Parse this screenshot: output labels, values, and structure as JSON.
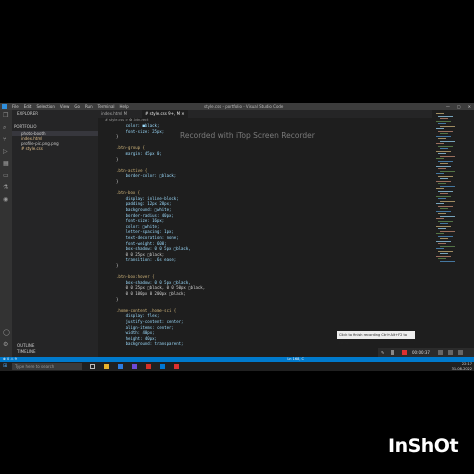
{
  "window": {
    "title": "style.css - portfolio - Visual Studio Code",
    "menu": [
      "File",
      "Edit",
      "Selection",
      "View",
      "Go",
      "Run",
      "Terminal",
      "Help"
    ],
    "controls": [
      "—",
      "▢",
      "✕"
    ]
  },
  "activity_icons": [
    "files-icon",
    "search-icon",
    "source-control-icon",
    "run-debug-icon",
    "extensions-icon",
    "remote-icon",
    "testing-icon",
    "docker-icon",
    "account-icon",
    "settings-icon"
  ],
  "sidebar": {
    "header": "EXPLORER",
    "section": "PORTFOLIO",
    "items": [
      {
        "label": "photo-booth"
      },
      {
        "label": "index.html"
      },
      {
        "label": "profile-pic.png.png"
      },
      {
        "label": "# style.css"
      }
    ],
    "outline": "OUTLINE",
    "timeline": "TIMELINE"
  },
  "tabs": [
    {
      "label": "index.html M"
    },
    {
      "label": "# style.css 9+, M ✕"
    }
  ],
  "breadcrumb": "# style.css > ✿ .btn-rect",
  "code": [
    {
      "n": "",
      "t": "    color: ■black;"
    },
    {
      "n": "",
      "t": "    font-size: 25px;"
    },
    {
      "n": "",
      "t": "}"
    },
    {
      "n": "",
      "t": ""
    },
    {
      "n": "",
      "t": ".btn-group {"
    },
    {
      "n": "",
      "t": "    margin: 45px 0;"
    },
    {
      "n": "",
      "t": "}"
    },
    {
      "n": "",
      "t": ""
    },
    {
      "n": "",
      "t": ".btn-active {"
    },
    {
      "n": "",
      "t": "    border-color: □black;"
    },
    {
      "n": "",
      "t": "}"
    },
    {
      "n": "",
      "t": ""
    },
    {
      "n": "",
      "t": ".btn-box {"
    },
    {
      "n": "",
      "t": "    display: inline-block;"
    },
    {
      "n": "",
      "t": "    padding: 12px 28px;"
    },
    {
      "n": "",
      "t": "    background: □white;"
    },
    {
      "n": "",
      "t": "    border-radius: 40px;"
    },
    {
      "n": "",
      "t": "    font-size: 16px;"
    },
    {
      "n": "",
      "t": "    color: □white;"
    },
    {
      "n": "",
      "t": "    letter-spacing: 1px;"
    },
    {
      "n": "",
      "t": "    text-decoration: none;"
    },
    {
      "n": "",
      "t": "    font-weight: 600;"
    },
    {
      "n": "",
      "t": "    box-shadow: 0 0 5px □black,"
    },
    {
      "n": "",
      "t": "    0 0 25px □black;"
    },
    {
      "n": "",
      "t": "    transition: .6s ease;"
    },
    {
      "n": "",
      "t": "}"
    },
    {
      "n": "",
      "t": ""
    },
    {
      "n": "",
      "t": ".btn-box:hover {"
    },
    {
      "n": "",
      "t": "    box-shadow: 0 0 5px □black,"
    },
    {
      "n": "",
      "t": "    0 0 25px □black, 0 0 50px □black,"
    },
    {
      "n": "",
      "t": "    0 0 100px 0 200px □black;"
    },
    {
      "n": "",
      "t": "}"
    },
    {
      "n": "",
      "t": ""
    },
    {
      "n": "",
      "t": ".home-content .home-sci {"
    },
    {
      "n": "",
      "t": "    display: flex;"
    },
    {
      "n": "",
      "t": "    justify-content: center;"
    },
    {
      "n": "",
      "t": "    align-items: center;"
    },
    {
      "n": "",
      "t": "    width: 40px;"
    },
    {
      "n": "",
      "t": "    height: 40px;"
    },
    {
      "n": "",
      "t": "    background: transparent;"
    }
  ],
  "status": {
    "left": "⊗ 0 ⚠ 9",
    "right": "Ln 168, C"
  },
  "recorder_tooltip": "Click to finish recording   Ctrl+Alt+F2 to Finish",
  "recorder_time": "00:00:37",
  "watermark": "Recorded with iTop Screen Recorder",
  "taskbar": {
    "search": "Type here to search",
    "time": "22:17",
    "date": "31-08-2022"
  },
  "brand": "InShOt",
  "colors": {
    "accent": "#007acc",
    "rec_red": "#e03030"
  }
}
